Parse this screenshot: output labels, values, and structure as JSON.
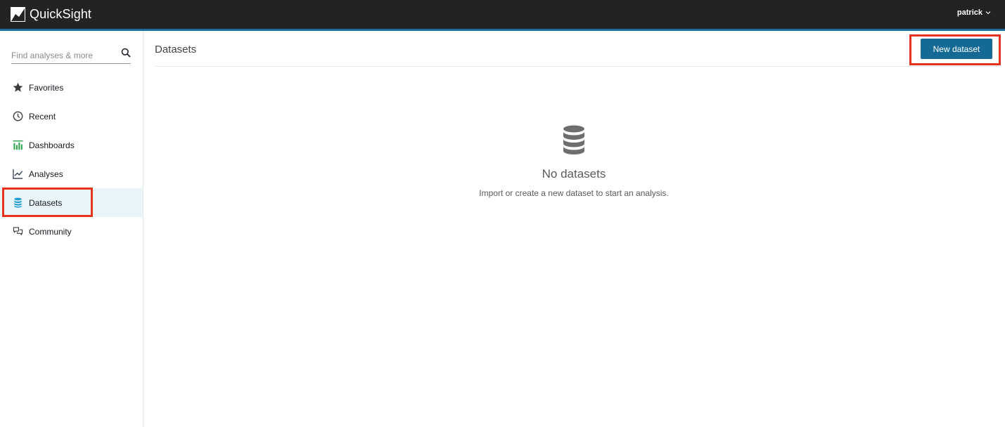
{
  "app": {
    "name": "QuickSight",
    "user": "patrick"
  },
  "sidebar": {
    "search_placeholder": "Find analyses & more",
    "items": [
      {
        "label": "Favorites",
        "icon": "star-icon"
      },
      {
        "label": "Recent",
        "icon": "clock-icon"
      },
      {
        "label": "Dashboards",
        "icon": "bar-chart-icon"
      },
      {
        "label": "Analyses",
        "icon": "line-chart-icon"
      },
      {
        "label": "Datasets",
        "icon": "database-icon",
        "active": true
      },
      {
        "label": "Community",
        "icon": "chat-bubbles-icon"
      }
    ]
  },
  "main": {
    "title": "Datasets",
    "new_button": "New dataset",
    "empty": {
      "icon": "database-icon",
      "title": "No datasets",
      "description": "Import or create a new dataset to start an analysis."
    }
  },
  "colors": {
    "topbar": "#232323",
    "accent": "#1a6fa0",
    "button": "#146a94",
    "active_item": "#e9f4fb",
    "highlight": "#e8331c",
    "dashboards_icon": "#2ea44f",
    "datasets_icon": "#1b9bd1"
  }
}
